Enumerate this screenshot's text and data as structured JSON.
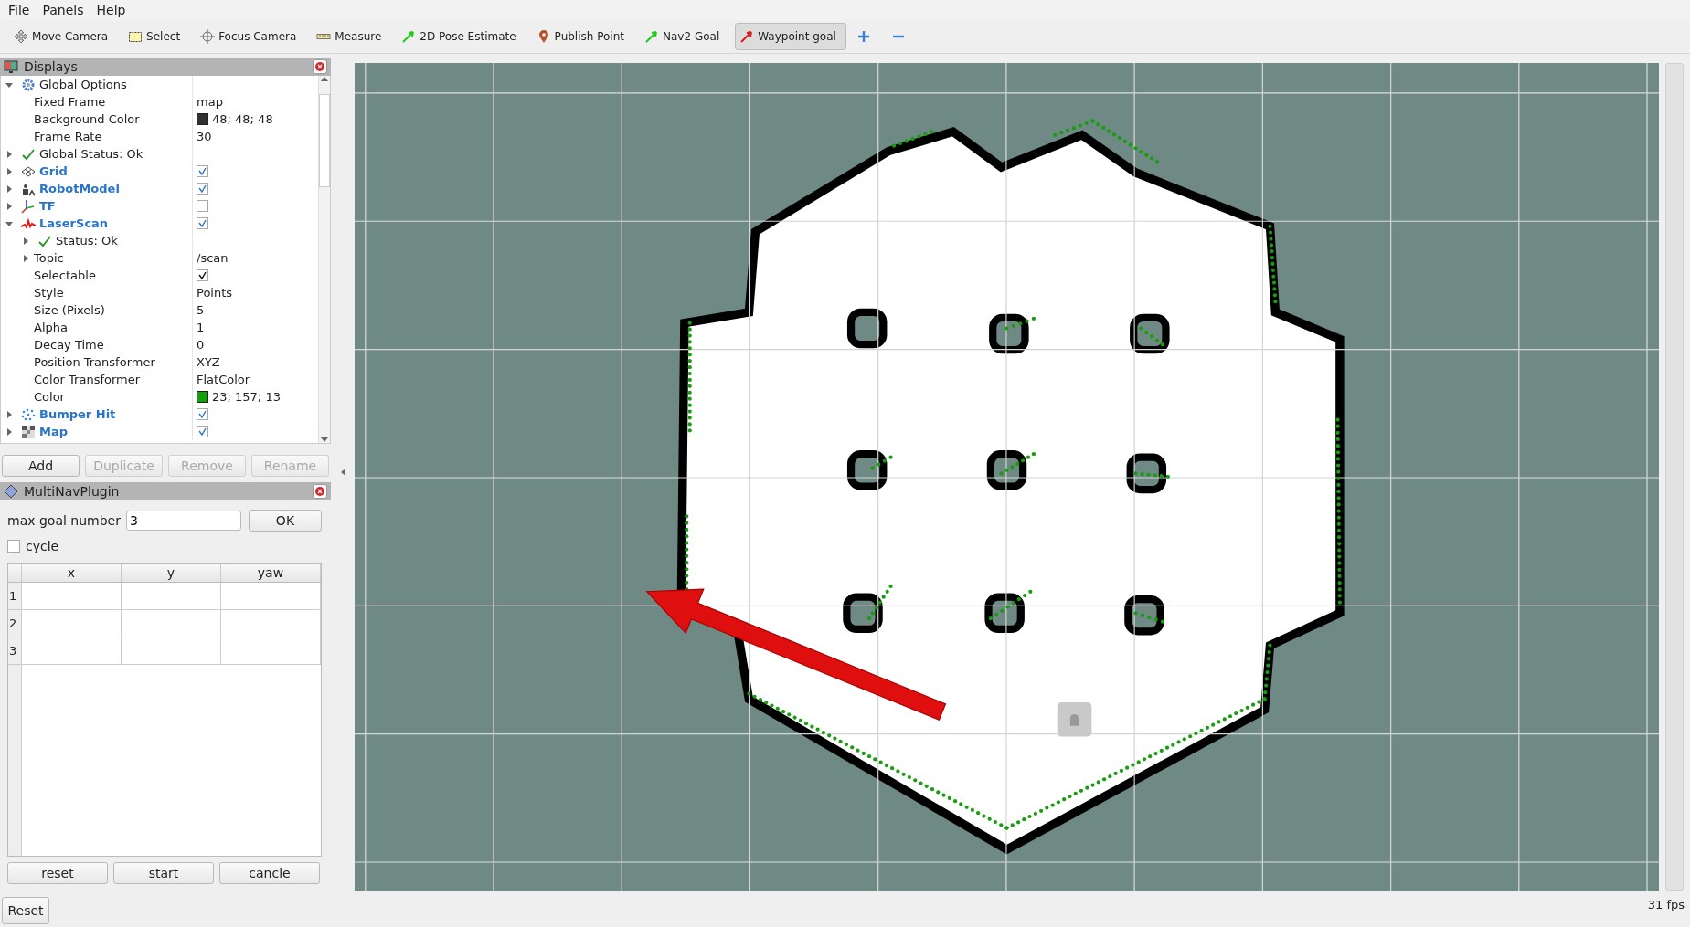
{
  "menu": [
    "File",
    "Panels",
    "Help"
  ],
  "toolbar": [
    {
      "kind": "move",
      "label": "Move Camera",
      "selected": false
    },
    {
      "kind": "select",
      "label": "Select",
      "selected": false
    },
    {
      "kind": "focus",
      "label": "Focus Camera",
      "selected": false
    },
    {
      "kind": "measure",
      "label": "Measure",
      "selected": false
    },
    {
      "kind": "pose",
      "label": "2D Pose Estimate",
      "selected": false
    },
    {
      "kind": "point",
      "label": "Publish Point",
      "selected": false
    },
    {
      "kind": "goal",
      "label": "Nav2 Goal",
      "selected": false
    },
    {
      "kind": "waypoint",
      "label": "Waypoint goal",
      "selected": true
    },
    {
      "kind": "add",
      "selected": false
    },
    {
      "kind": "remove",
      "selected": false
    }
  ],
  "displays": {
    "title": "Displays",
    "items": [
      {
        "kind": "options",
        "label": "Global Options",
        "expanded": true,
        "children": [
          {
            "kind": "property",
            "label": "Fixed Frame",
            "value": "map"
          },
          {
            "kind": "property",
            "label": "Background Color",
            "value": "48; 48; 48",
            "color": "#303030"
          },
          {
            "kind": "property",
            "label": "Frame Rate",
            "value": "30"
          }
        ]
      },
      {
        "kind": "status",
        "label": "Global Status: Ok",
        "expanded": false
      },
      {
        "kind": "grid",
        "label": "Grid",
        "checked": true,
        "expanded": false
      },
      {
        "kind": "robot_model",
        "label": "RobotModel",
        "checked": true,
        "expanded": false
      },
      {
        "kind": "tf",
        "label": "TF",
        "checked": false,
        "expanded": false
      },
      {
        "kind": "laser_scan",
        "label": "LaserScan",
        "checked": true,
        "expanded": true,
        "children": [
          {
            "kind": "status",
            "label": "Status: Ok",
            "expanded": false
          },
          {
            "kind": "property",
            "label": "Topic",
            "value": "/scan",
            "expanded": false
          },
          {
            "kind": "property",
            "label": "Selectable",
            "checked": true
          },
          {
            "kind": "property",
            "label": "Style",
            "value": "Points"
          },
          {
            "kind": "property",
            "label": "Size (Pixels)",
            "value": "5"
          },
          {
            "kind": "property",
            "label": "Alpha",
            "value": "1"
          },
          {
            "kind": "property",
            "label": "Decay Time",
            "value": "0"
          },
          {
            "kind": "property",
            "label": "Position Transformer",
            "value": "XYZ"
          },
          {
            "kind": "property",
            "label": "Color Transformer",
            "value": "FlatColor"
          },
          {
            "kind": "property",
            "label": "Color",
            "value": "23; 157; 13",
            "color": "#179d0d"
          }
        ]
      },
      {
        "kind": "bumper",
        "label": "Bumper Hit",
        "checked": true,
        "expanded": false
      },
      {
        "kind": "map",
        "label": "Map",
        "checked": true,
        "expanded": false
      }
    ],
    "buttons": [
      {
        "label": "Add",
        "disabled": false
      },
      {
        "label": "Duplicate",
        "disabled": true
      },
      {
        "label": "Remove",
        "disabled": true
      },
      {
        "label": "Rename",
        "disabled": true
      }
    ]
  },
  "plugin": {
    "title": "MultiNavPlugin",
    "max_goal_label": "max goal number",
    "max_goal_value": "3",
    "ok_button": "OK",
    "cycle": {
      "label": "cycle",
      "checked": false
    },
    "table": {
      "columns": [
        "x",
        "y",
        "yaw"
      ],
      "rows": [
        "1",
        "2",
        "3"
      ]
    },
    "buttons": [
      "reset",
      "start",
      "cancle"
    ]
  },
  "status_bar": {
    "reset_button": "Reset",
    "fps": "31 fps"
  }
}
